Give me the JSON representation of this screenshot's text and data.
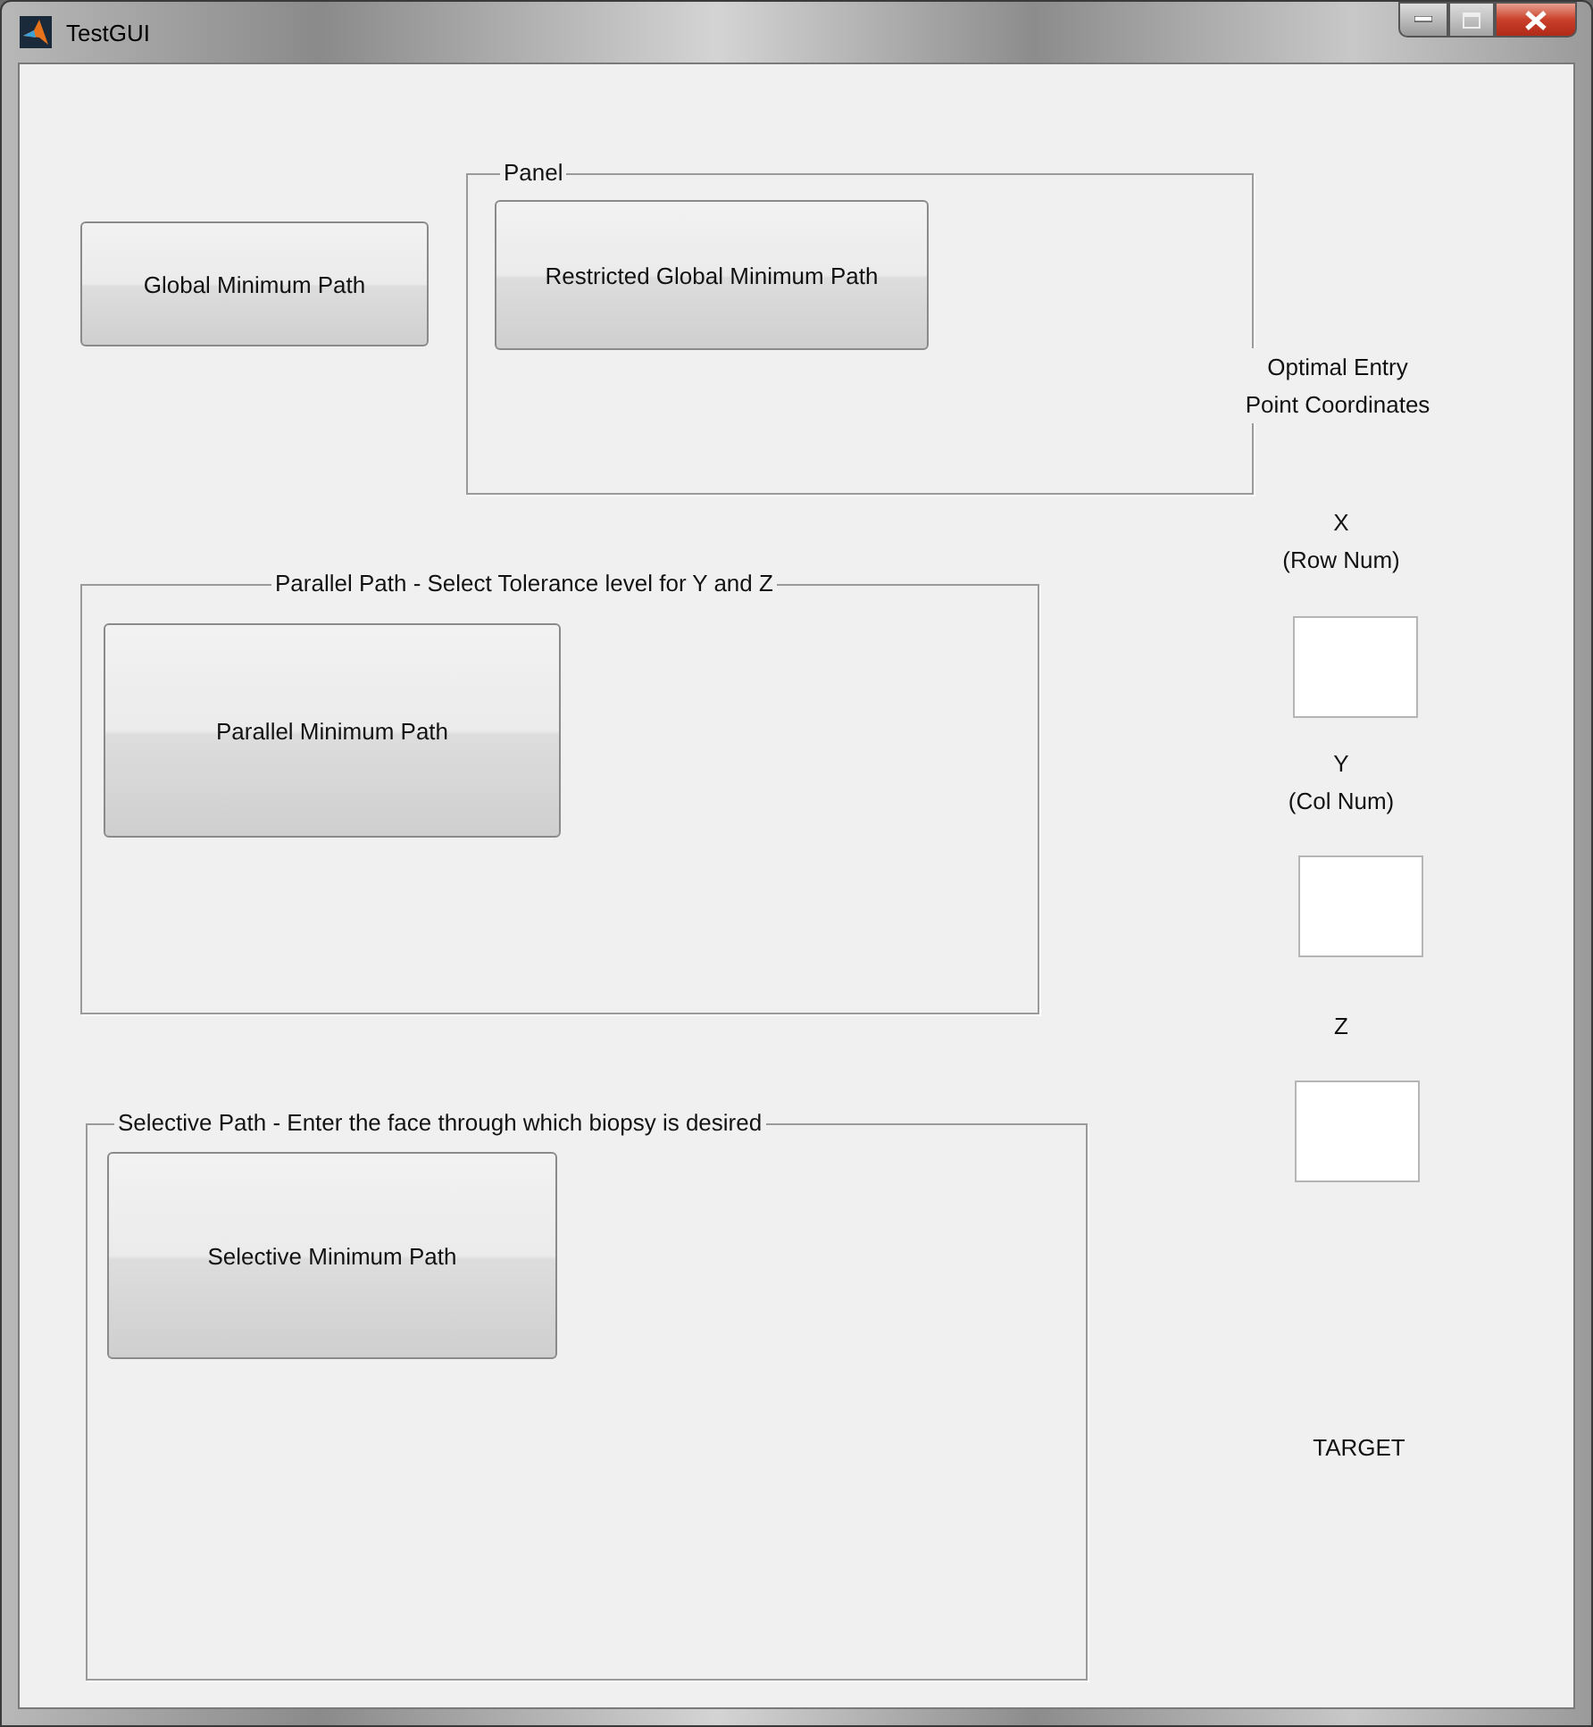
{
  "window": {
    "title": "TestGUI"
  },
  "global_button": {
    "label": "Global Minimum Path"
  },
  "panels": [
    {
      "title": "Panel",
      "button": "Restricted Global Minimum Path"
    },
    {
      "title": "Parallel Path - Select Tolerance level for Y and Z",
      "button": "Parallel Minimum Path"
    },
    {
      "title": "Selective Path - Enter the face through which biopsy is desired",
      "button": "Selective Minimum Path"
    }
  ],
  "coordinates": {
    "heading": "Optimal Entry Point Coordinates",
    "fields": [
      {
        "label": "X\n(Row Num)"
      },
      {
        "label": "Y\n(Col Num)"
      },
      {
        "label": "Z"
      }
    ]
  },
  "target_label": "TARGET"
}
